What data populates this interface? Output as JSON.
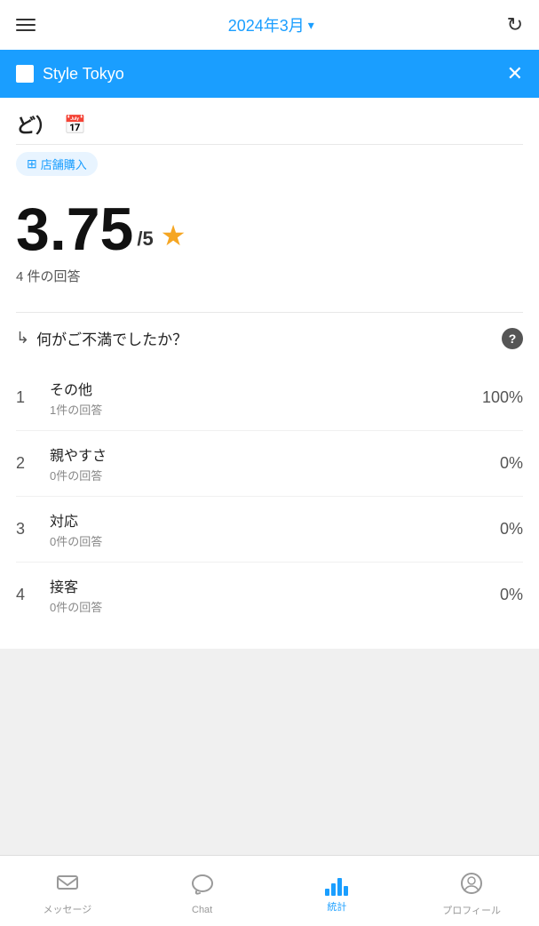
{
  "topbar": {
    "title": "2024年3月",
    "chevron": "▾",
    "refresh_icon": "↻"
  },
  "store": {
    "name": "Style Tokyo",
    "close_icon": "✕"
  },
  "partial": {
    "text": "ど）",
    "tag_label": "店舗購入"
  },
  "rating": {
    "number": "3.75",
    "denom": "/5",
    "star": "★",
    "count": "4 件の回答"
  },
  "question": {
    "arrow": "↳",
    "text": "何がご不満でしたか？",
    "help": "?"
  },
  "items": [
    {
      "rank": "1",
      "label": "その他",
      "sub": "1件の回答",
      "pct": "100%"
    },
    {
      "rank": "2",
      "label": "親やすさ",
      "sub": "0件の回答",
      "pct": "0%"
    },
    {
      "rank": "3",
      "label": "対応",
      "sub": "0件の回答",
      "pct": "0%"
    },
    {
      "rank": "4",
      "label": "接客",
      "sub": "0件の回答",
      "pct": "0%"
    }
  ],
  "nav": {
    "items": [
      {
        "key": "messages",
        "label": "メッセージ",
        "active": false
      },
      {
        "key": "chat",
        "label": "Chat",
        "active": false
      },
      {
        "key": "stats",
        "label": "統計",
        "active": true
      },
      {
        "key": "profile",
        "label": "プロフィール",
        "active": false
      }
    ]
  }
}
